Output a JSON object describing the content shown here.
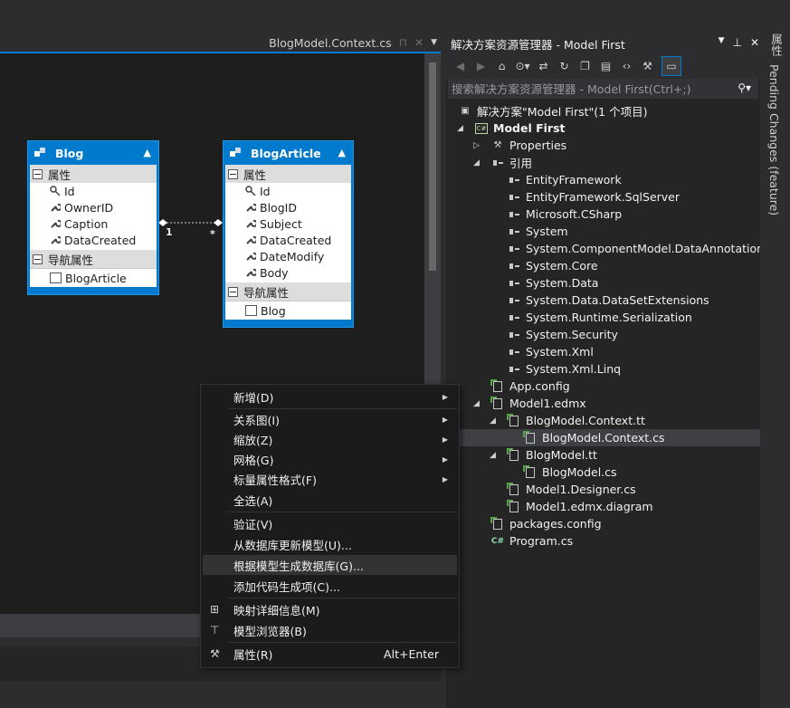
{
  "designer": {
    "tab_title": "BlogModel.Context.cs",
    "entities": [
      {
        "name": "Blog",
        "section_properties": "属性",
        "properties": [
          "Id",
          "OwnerID",
          "Caption",
          "DataCreated"
        ],
        "section_navigation": "导航属性",
        "navigation": [
          "BlogArticle"
        ]
      },
      {
        "name": "BlogArticle",
        "section_properties": "属性",
        "properties": [
          "Id",
          "BlogID",
          "Subject",
          "DataCreated",
          "DateModify",
          "Body"
        ],
        "section_navigation": "导航属性",
        "navigation": [
          "Blog"
        ]
      }
    ],
    "association": {
      "left_multiplicity": "1",
      "right_multiplicity": "*"
    }
  },
  "context_menu": {
    "items": [
      {
        "label": "新增(D)",
        "submenu": true
      },
      {
        "label": "关系图(I)",
        "submenu": true
      },
      {
        "label": "缩放(Z)",
        "submenu": true
      },
      {
        "label": "网格(G)",
        "submenu": true
      },
      {
        "label": "标量属性格式(F)",
        "submenu": true
      },
      {
        "label": "全选(A)"
      },
      {
        "label": "验证(V)"
      },
      {
        "label": "从数据库更新模型(U)..."
      },
      {
        "label": "根据模型生成数据库(G)...",
        "highlighted": true
      },
      {
        "label": "添加代码生成项(C)..."
      },
      {
        "label": "映射详细信息(M)",
        "icon": "mapping-details-icon"
      },
      {
        "label": "模型浏览器(B)",
        "icon": "model-browser-icon"
      },
      {
        "label": "属性(R)",
        "icon": "wrench-icon",
        "shortcut": "Alt+Enter"
      }
    ]
  },
  "solution_explorer": {
    "title": "解决方案资源管理器 - Model First",
    "search_placeholder": "搜索解决方案资源管理器 - Model First(Ctrl+;)",
    "solution_label": "解决方案\"Model First\"(1 个项目)",
    "project": "Model First",
    "properties": "Properties",
    "references_label": "引用",
    "references": [
      "EntityFramework",
      "EntityFramework.SqlServer",
      "Microsoft.CSharp",
      "System",
      "System.ComponentModel.DataAnnotations",
      "System.Core",
      "System.Data",
      "System.Data.DataSetExtensions",
      "System.Runtime.Serialization",
      "System.Security",
      "System.Xml",
      "System.Xml.Linq"
    ],
    "app_config": "App.config",
    "edmx": "Model1.edmx",
    "context_tt": "BlogModel.Context.tt",
    "context_cs": "BlogModel.Context.cs",
    "model_tt": "BlogModel.tt",
    "model_cs": "BlogModel.cs",
    "designer_cs": "Model1.Designer.cs",
    "diagram": "Model1.edmx.diagram",
    "packages_config": "packages.config",
    "program_cs": "Program.cs"
  },
  "side_tabs": {
    "properties": "属性",
    "pending_changes": "Pending Changes (feature)"
  },
  "colors": {
    "accent": "#007acc",
    "background": "#1e1e1e",
    "panel": "#252526"
  }
}
